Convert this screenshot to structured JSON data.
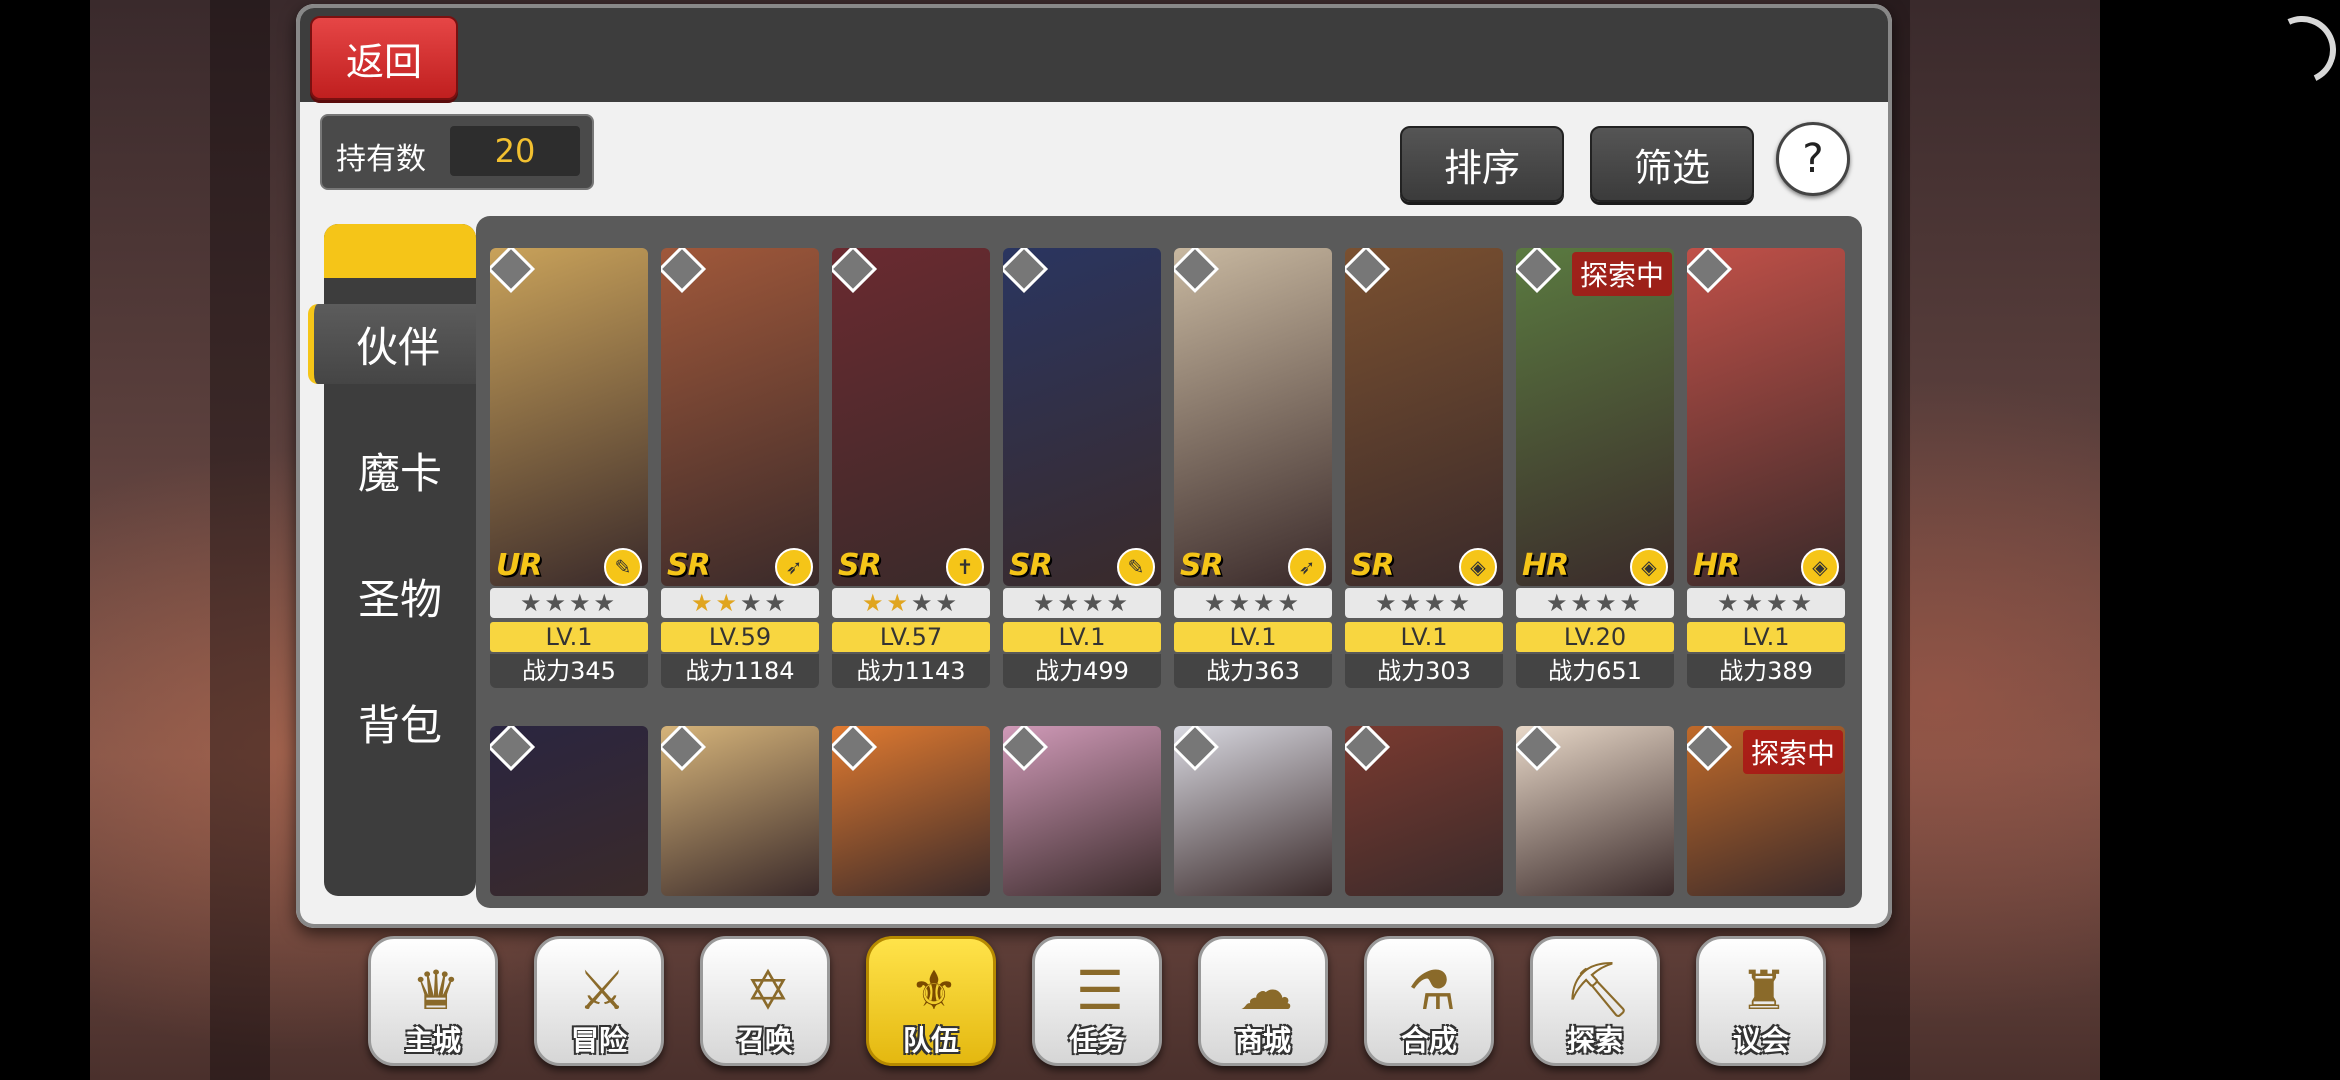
{
  "header": {
    "back_label": "返回"
  },
  "owned": {
    "label": "持有数",
    "value": "20"
  },
  "toolbar": {
    "sort_label": "排序",
    "filter_label": "筛选",
    "help_label": "?"
  },
  "tabs": [
    {
      "label": "伙伴",
      "active": true
    },
    {
      "label": "魔卡",
      "active": false
    },
    {
      "label": "圣物",
      "active": false
    },
    {
      "label": "背包",
      "active": false
    }
  ],
  "cards_row1": [
    {
      "rarity": "UR",
      "stars_gold": 0,
      "stars_total": 4,
      "level": "LV.1",
      "power": "战力345",
      "portrait_color": "#c9a25a",
      "class_icon": "staff-icon",
      "explore": ""
    },
    {
      "rarity": "SR",
      "stars_gold": 2,
      "stars_total": 4,
      "level": "LV.59",
      "power": "战力1184",
      "portrait_color": "#a0583a",
      "class_icon": "bow-icon",
      "explore": ""
    },
    {
      "rarity": "SR",
      "stars_gold": 2,
      "stars_total": 4,
      "level": "LV.57",
      "power": "战力1143",
      "portrait_color": "#6a2a30",
      "class_icon": "cross-icon",
      "explore": ""
    },
    {
      "rarity": "SR",
      "stars_gold": 0,
      "stars_total": 4,
      "level": "LV.1",
      "power": "战力499",
      "portrait_color": "#2a3560",
      "class_icon": "staff-icon",
      "explore": ""
    },
    {
      "rarity": "SR",
      "stars_gold": 0,
      "stars_total": 4,
      "level": "LV.1",
      "power": "战力363",
      "portrait_color": "#c8b8a0",
      "class_icon": "bow-icon",
      "explore": ""
    },
    {
      "rarity": "SR",
      "stars_gold": 0,
      "stars_total": 4,
      "level": "LV.1",
      "power": "战力303",
      "portrait_color": "#7a5030",
      "class_icon": "shield-icon",
      "explore": ""
    },
    {
      "rarity": "HR",
      "stars_gold": 0,
      "stars_total": 4,
      "level": "LV.20",
      "power": "战力651",
      "portrait_color": "#5a7a40",
      "class_icon": "shield-icon",
      "explore": "探索中"
    },
    {
      "rarity": "HR",
      "stars_gold": 0,
      "stars_total": 4,
      "level": "LV.1",
      "power": "战力389",
      "portrait_color": "#c05048",
      "class_icon": "shield-icon",
      "explore": ""
    }
  ],
  "cards_row2": [
    {
      "portrait_color": "#2a2540",
      "explore": ""
    },
    {
      "portrait_color": "#d6b47a",
      "explore": ""
    },
    {
      "portrait_color": "#e07a30",
      "explore": ""
    },
    {
      "portrait_color": "#d09ab8",
      "explore": ""
    },
    {
      "portrait_color": "#d8d8e0",
      "explore": ""
    },
    {
      "portrait_color": "#7a3a30",
      "explore": ""
    },
    {
      "portrait_color": "#e8d8c8",
      "explore": ""
    },
    {
      "portrait_color": "#c06a2a",
      "explore": "探索中"
    }
  ],
  "nav": [
    {
      "label": "主城",
      "icon": "crown-icon",
      "glyph": "♛",
      "active": false
    },
    {
      "label": "冒险",
      "icon": "crossed-swords-icon",
      "glyph": "⚔",
      "active": false
    },
    {
      "label": "召唤",
      "icon": "summon-card-icon",
      "glyph": "✡",
      "active": false
    },
    {
      "label": "队伍",
      "icon": "winged-emblem-icon",
      "glyph": "⚜",
      "active": true
    },
    {
      "label": "任务",
      "icon": "quest-book-icon",
      "glyph": "☰",
      "active": false
    },
    {
      "label": "商城",
      "icon": "shop-icon",
      "glyph": "☁",
      "active": false
    },
    {
      "label": "合成",
      "icon": "alchemy-flask-icon",
      "glyph": "⚗",
      "active": false
    },
    {
      "label": "探索",
      "icon": "compass-shovel-icon",
      "glyph": "⛏",
      "active": false
    },
    {
      "label": "议会",
      "icon": "council-emblem-icon",
      "glyph": "♜",
      "active": false
    }
  ],
  "colors": {
    "accent": "#f5c518",
    "back_red": "#d93232",
    "panel_dark": "#3d3d3d"
  }
}
